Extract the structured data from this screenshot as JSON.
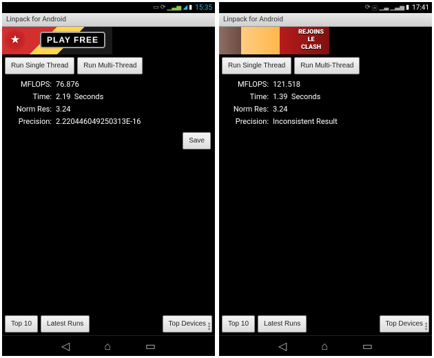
{
  "left": {
    "status": {
      "time": "15:35"
    },
    "title": "Linpack for Android",
    "ad": {
      "label": "PLAY FREE"
    },
    "buttons": {
      "single": "Run Single Thread",
      "multi": "Run Multi-Thread"
    },
    "results": {
      "mflops_label": "MFLOPS:",
      "mflops": "76.876",
      "time_label": "Time:",
      "time": "2.19",
      "time_unit": "Seconds",
      "norm_label": "Norm Res:",
      "norm": "3.24",
      "precision_label": "Precision:",
      "precision": "2.220446049250313E-16"
    },
    "save": "Save",
    "bottom": {
      "top10": "Top 10",
      "latest": "Latest Runs",
      "topdev": "Top Devices"
    }
  },
  "right": {
    "status": {
      "time": "17:41"
    },
    "title": "Linpack for Android",
    "ad": {
      "line1": "REJOINS",
      "line2": "LE",
      "line3": "CLASH"
    },
    "buttons": {
      "single": "Run Single Thread",
      "multi": "Run Multi-Thread"
    },
    "results": {
      "mflops_label": "MFLOPS:",
      "mflops": "121.518",
      "time_label": "Time:",
      "time": "1.39",
      "time_unit": "Seconds",
      "norm_label": "Norm Res:",
      "norm": "3.24",
      "precision_label": "Precision:",
      "precision": "Inconsistent Result"
    },
    "bottom": {
      "top10": "Top 10",
      "latest": "Latest Runs",
      "topdev": "Top Devices"
    }
  }
}
